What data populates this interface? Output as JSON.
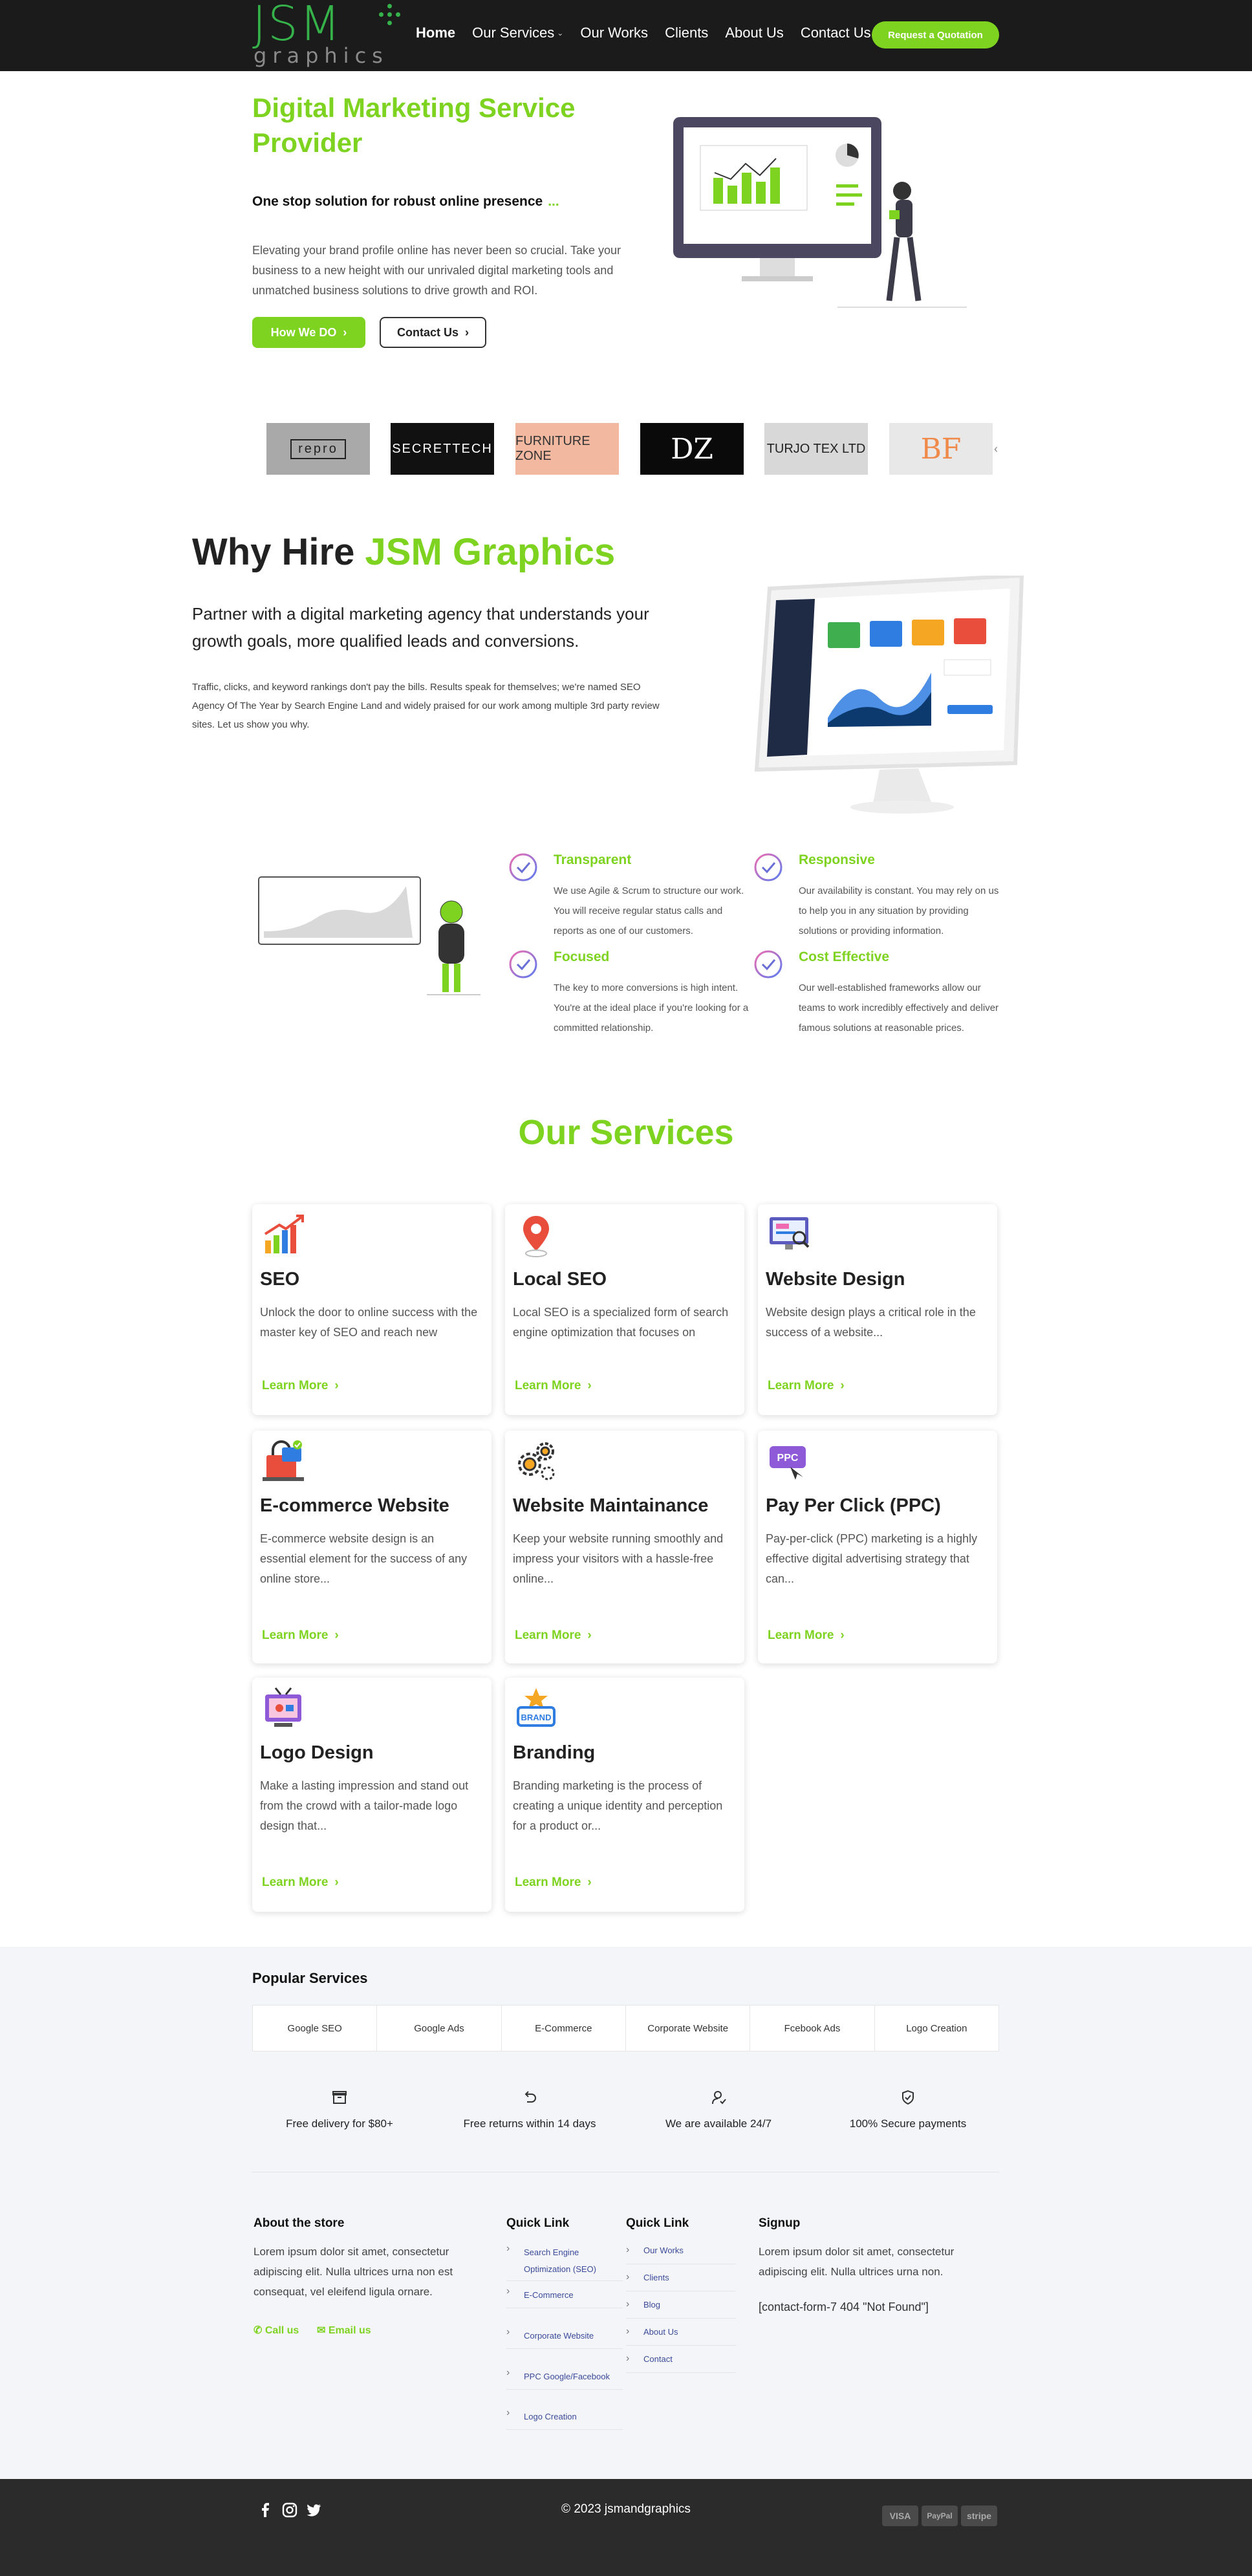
{
  "header": {
    "logo_text": "JSM",
    "logo_subtext": "graphics",
    "nav": [
      {
        "label": "Home"
      },
      {
        "label": "Our Services"
      },
      {
        "label": "Our Works"
      },
      {
        "label": "Clients"
      },
      {
        "label": "About Us"
      },
      {
        "label": "Contact Us"
      }
    ],
    "cta_label": "Request a Quotation"
  },
  "hero": {
    "title": "Digital Marketing Service Provider",
    "subtitle": "One stop solution for robust online presence",
    "subtitle_dots": "...",
    "description": "Elevating your brand profile online has never been so crucial. Take your business to a new height with our unrivaled digital marketing tools and unmatched business solutions to drive growth and ROI.",
    "primary_button": "How We DO",
    "secondary_button": "Contact Us"
  },
  "clients": [
    {
      "name": "repro",
      "bg": "#a9a9a9",
      "fg": "#222"
    },
    {
      "name": "SECRETTECH",
      "bg": "#111111",
      "fg": "#fff"
    },
    {
      "name": "FURNITURE ZONE",
      "bg": "#f2b9a0",
      "fg": "#333"
    },
    {
      "name": "DZ",
      "bg": "#0a0a0a",
      "fg": "#fff"
    },
    {
      "name": "TURJO TEX LTD",
      "bg": "#d8d8d8",
      "fg": "#222"
    },
    {
      "name": "BF",
      "bg": "#e8e8e8",
      "fg": "#f08a4b"
    }
  ],
  "why": {
    "title_prefix": "Why Hire",
    "title_highlight": "JSM Graphics",
    "lead": "Partner with a digital marketing agency that understands your growth goals, more qualified leads and conversions.",
    "text": "Traffic, clicks, and keyword rankings don't pay the bills. Results speak for themselves; we're named SEO Agency Of The Year by Search Engine Land and widely praised for our work among multiple 3rd party review sites. Let us show you why."
  },
  "features": [
    {
      "title": "Transparent",
      "text": "We use Agile & Scrum to structure our work. You will receive regular status calls and reports as one of our customers."
    },
    {
      "title": "Responsive",
      "text": "Our availability is constant. You may rely on us to help you in any situation by providing solutions or providing information."
    },
    {
      "title": "Focused",
      "text": "The key to more conversions is high intent. You're at the ideal place if you're looking for a committed relationship."
    },
    {
      "title": "Cost Effective",
      "text": "Our well-established frameworks allow our teams to work incredibly effectively and deliver famous solutions at reasonable prices."
    }
  ],
  "services": {
    "heading": "Our Services",
    "link_label": "Learn More",
    "items": [
      {
        "title": "SEO",
        "desc": "Unlock the door to online success with the master key of SEO and reach new",
        "icon": "chart-growth-icon"
      },
      {
        "title": "Local SEO",
        "desc": "Local SEO is a specialized form of search engine optimization that focuses on",
        "icon": "map-pin-icon"
      },
      {
        "title": "Website Design",
        "desc": "Website design plays a critical role in the success of a website...",
        "icon": "design-monitor-icon"
      },
      {
        "title": "E-commerce Website",
        "desc": "E-commerce website design is an essential element for the success of any online store...",
        "icon": "shop-bag-icon"
      },
      {
        "title": "Website Maintainance",
        "desc": "Keep your website running smoothly and impress your visitors with a hassle-free online...",
        "icon": "gears-icon"
      },
      {
        "title": "Pay Per Click (PPC)",
        "desc": "Pay-per-click (PPC) marketing is a highly effective digital advertising strategy that can...",
        "icon": "ppc-icon"
      },
      {
        "title": "Logo Design",
        "desc": "Make a lasting impression and stand out from the crowd with a tailor-made logo design that...",
        "icon": "logo-tv-icon"
      },
      {
        "title": "Branding",
        "desc": "Branding marketing is the process of creating a unique identity and perception for a product or...",
        "icon": "brand-badge-icon"
      }
    ]
  },
  "popular": {
    "title": "Popular Services",
    "items": [
      "Google SEO",
      "Google Ads",
      "E-Commerce",
      "Corporate Website",
      "Fcebook Ads",
      "Logo Creation"
    ]
  },
  "perks": [
    {
      "label": "Free delivery for $80+",
      "icon": "box-icon"
    },
    {
      "label": "Free returns within 14 days",
      "icon": "return-icon"
    },
    {
      "label": "We are available 24/7",
      "icon": "support-user-icon"
    },
    {
      "label": "100% Secure payments",
      "icon": "secure-shield-icon"
    }
  ],
  "footer": {
    "about_title": "About the store",
    "about_text": "Lorem ipsum dolor sit amet, consectetur adipiscing elit. Nulla ultrices urna non est consequat, vel eleifend ligula ornare.",
    "call_label": "Call us",
    "email_label": "Email us",
    "quick1_title": "Quick Link",
    "quick1": [
      "Search Engine Optimization (SEO)",
      "E-Commerce",
      "Corporate Website",
      "PPC Google/Facebook",
      "Logo Creation"
    ],
    "quick2_title": "Quick Link",
    "quick2": [
      "Our Works",
      "Clients",
      "Blog",
      "About Us",
      "Contact"
    ],
    "signup_title": "Signup",
    "signup_text": "Lorem ipsum dolor sit amet, consectetur adipiscing elit. Nulla ultrices urna non.",
    "signup_form": "[contact-form-7 404 \"Not Found\"]",
    "copyright": "© 2023 jsmandgraphics",
    "payments": [
      "VISA",
      "PayPal",
      "stripe"
    ]
  }
}
